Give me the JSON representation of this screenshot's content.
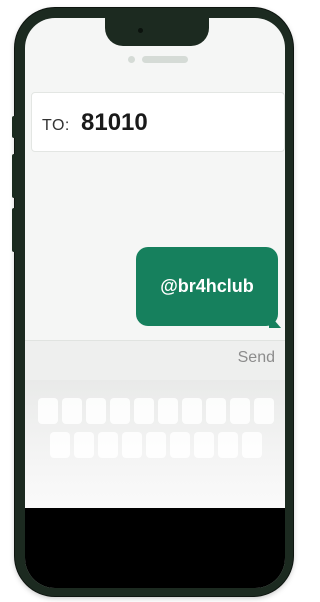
{
  "message": {
    "to_label": "TO:",
    "recipient": "81010",
    "bubble_text": "@br4hclub",
    "send_label": "Send"
  },
  "colors": {
    "bubble": "#16805d",
    "phone_frame": "#1c2a20"
  }
}
